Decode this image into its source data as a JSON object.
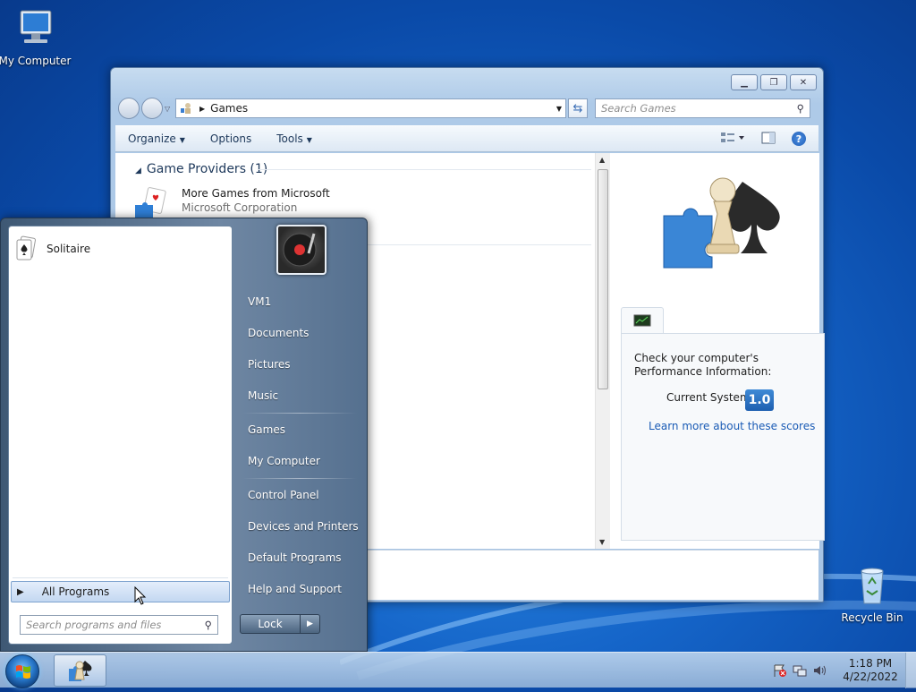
{
  "desktop": {
    "icons": [
      {
        "label": "My Computer"
      },
      {
        "label": "Recycle Bin"
      }
    ]
  },
  "explorer": {
    "address": "Games",
    "search_placeholder": "Search Games",
    "toolbar": {
      "organize": "Organize",
      "options": "Options",
      "tools": "Tools"
    },
    "group": {
      "title": "Game Providers (1)"
    },
    "provider": {
      "name": "More Games from Microsoft",
      "company": "Microsoft Corporation"
    },
    "performance": {
      "message": "Check your computer's Performance Information:",
      "current_label": "Current System",
      "score": "1.0",
      "learn_more": "Learn more about these scores"
    }
  },
  "start_menu": {
    "pinned": [
      {
        "label": "Solitaire"
      }
    ],
    "all_programs": "All Programs",
    "search_placeholder": "Search programs and files",
    "right_items": [
      "VM1",
      "Documents",
      "Pictures",
      "Music",
      "Games",
      "My Computer",
      "Control Panel",
      "Devices and Printers",
      "Default Programs",
      "Help and Support"
    ],
    "lock_label": "Lock"
  },
  "taskbar": {
    "time": "1:18 PM",
    "date": "4/22/2022"
  },
  "colors": {
    "accent": "#1a5bb5",
    "score_badge": "#2a70c2"
  }
}
